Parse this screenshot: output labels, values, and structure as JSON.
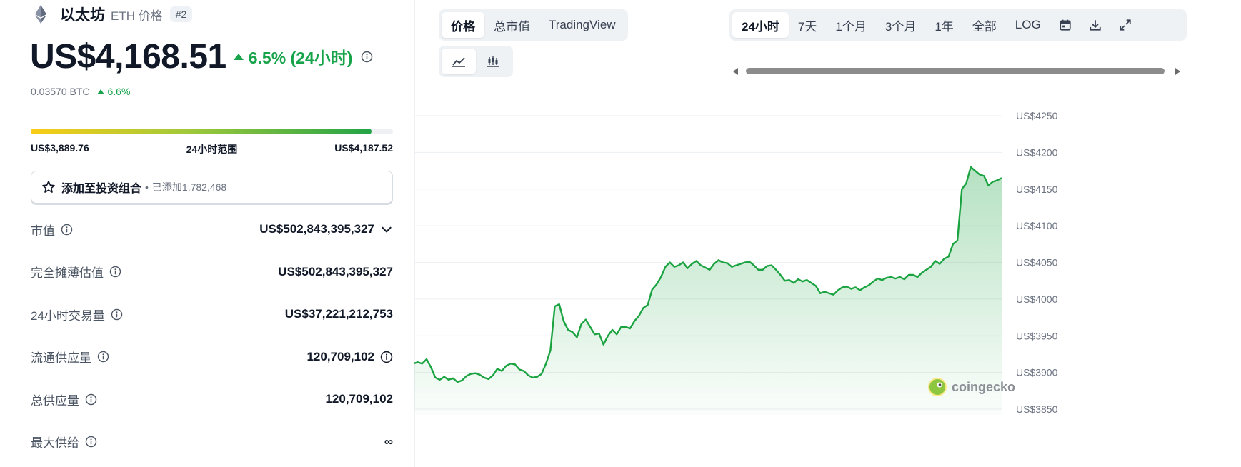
{
  "coin": {
    "name": "以太坊",
    "symbol_label": "ETH 价格",
    "rank": "#2",
    "price": "US$4,168.51",
    "change": "6.5% (24小时)",
    "btc_price": "0.03570 BTC",
    "btc_change": "6.6%"
  },
  "range": {
    "low": "US$3,889.76",
    "label": "24小时范围",
    "high": "US$4,187.52",
    "position_fraction": 0.94
  },
  "portfolio": {
    "label": "添加至投资组合",
    "added": "已添加1,782,468"
  },
  "stats": [
    {
      "label": "市值",
      "value": "US$502,843,395,327"
    },
    {
      "label": "完全摊薄估值",
      "value": "US$502,843,395,327"
    },
    {
      "label": "24小时交易量",
      "value": "US$37,221,212,753"
    },
    {
      "label": "流通供应量",
      "value": "120,709,102"
    },
    {
      "label": "总供应量",
      "value": "120,709,102"
    },
    {
      "label": "最大供给",
      "value": "∞"
    }
  ],
  "tabs": {
    "price": "价格",
    "market_cap": "总市值",
    "tradingview": "TradingView"
  },
  "chart_modes": [
    "line-chart-icon",
    "candlestick-icon"
  ],
  "ranges": {
    "h24": "24小时",
    "d7": "7天",
    "m1": "1个月",
    "m3": "3个月",
    "y1": "1年",
    "all": "全部",
    "log": "LOG"
  },
  "colors": {
    "up": "#16a34a",
    "line": "#1aa340"
  },
  "watermark": "coingecko",
  "chart_data": {
    "type": "area",
    "title": "",
    "xlabel": "",
    "ylabel": "",
    "ylim": [
      3850,
      4250
    ],
    "y_ticks": [
      "US$4250",
      "US$4200",
      "US$4150",
      "US$4100",
      "US$4050",
      "US$4000",
      "US$3950",
      "US$3900",
      "US$3850"
    ],
    "y_tick_values": [
      4250,
      4200,
      4150,
      4100,
      4050,
      4000,
      3950,
      3900,
      3850
    ],
    "grid": true,
    "x": [
      0,
      1,
      2,
      3,
      4,
      5,
      6,
      7,
      8,
      9,
      10,
      11,
      12,
      13,
      14,
      15,
      16,
      17,
      18,
      19,
      20,
      21,
      22,
      23,
      24,
      25,
      26,
      27,
      28,
      29,
      30,
      31,
      32,
      33,
      34,
      35,
      36,
      37,
      38,
      39,
      40,
      41,
      42,
      43,
      44,
      45,
      46,
      47,
      48,
      49,
      50,
      51,
      52,
      53,
      54,
      55,
      56,
      57,
      58,
      59,
      60,
      61,
      62,
      63,
      64,
      65,
      66,
      67,
      68,
      69,
      70,
      71,
      72,
      73,
      74,
      75,
      76,
      77,
      78,
      79,
      80,
      81,
      82,
      83,
      84,
      85,
      86,
      87,
      88,
      89,
      90,
      91,
      92,
      93,
      94,
      95,
      96,
      97,
      98,
      99,
      100,
      101,
      102,
      103,
      104,
      105,
      106,
      107,
      108,
      109,
      110,
      111,
      112,
      113,
      114,
      115,
      116,
      117,
      118,
      119,
      120,
      121,
      122,
      123,
      124,
      125,
      126,
      127,
      128,
      129,
      130,
      131,
      132,
      133,
      134,
      135,
      136,
      137,
      138,
      139,
      140,
      141,
      142,
      143,
      144,
      145,
      146,
      147,
      148,
      149,
      150,
      151,
      152,
      153,
      154,
      155,
      156,
      157,
      158,
      159,
      160,
      161,
      162,
      163,
      164,
      165,
      166,
      167,
      168,
      169,
      170,
      171,
      172,
      173,
      174,
      175,
      176,
      177,
      178,
      179,
      180
    ],
    "values": [
      3910,
      3913,
      3912,
      3914,
      3912,
      3918,
      3907,
      3893,
      3890,
      3894,
      3890,
      3892,
      3887,
      3889,
      3895,
      3898,
      3899,
      3897,
      3893,
      3891,
      3896,
      3905,
      3902,
      3909,
      3912,
      3911,
      3904,
      3902,
      3896,
      3893,
      3894,
      3898,
      3912,
      3930,
      3990,
      3993,
      3970,
      3958,
      3955,
      3948,
      3966,
      3972,
      3962,
      3952,
      3953,
      3938,
      3950,
      3958,
      3952,
      3962,
      3962,
      3960,
      3970,
      3977,
      3988,
      3992,
      4013,
      4020,
      4030,
      4044,
      4050,
      4044,
      4046,
      4050,
      4042,
      4048,
      4052,
      4046,
      4043,
      4040,
      4048,
      4053,
      4050,
      4049,
      4044,
      4046,
      4048,
      4050,
      4051,
      4046,
      4040,
      4040,
      4045,
      4046,
      4040,
      4033,
      4025,
      4026,
      4022,
      4027,
      4024,
      4026,
      4022,
      4018,
      4008,
      4010,
      4008,
      4006,
      4012,
      4016,
      4017,
      4014,
      4016,
      4012,
      4016,
      4019,
      4024,
      4028,
      4026,
      4029,
      4030,
      4028,
      4030,
      4027,
      4033,
      4033,
      4030,
      4036,
      4040,
      4044,
      4052,
      4048,
      4055,
      4058,
      4075,
      4080,
      4150,
      4158,
      4180,
      4175,
      4170,
      4168,
      4155,
      4160,
      4162,
      4165
    ]
  }
}
